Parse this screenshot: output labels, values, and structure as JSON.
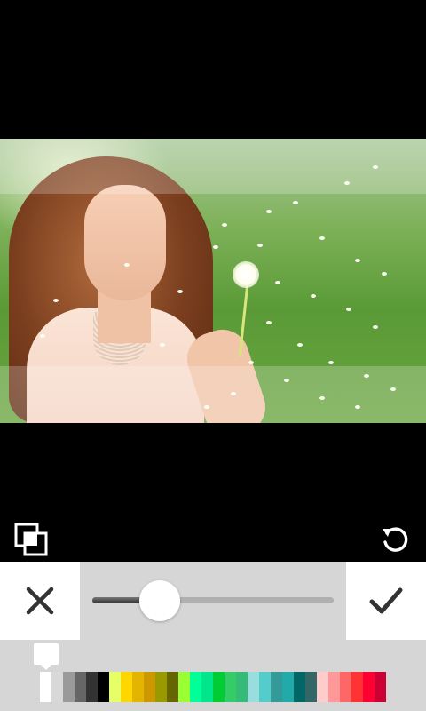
{
  "photo": {
    "description_icon": "photo-canvas"
  },
  "toolbar": {
    "compare_icon": "compare-layers-icon",
    "reset_icon": "rotate-reset-icon"
  },
  "controls": {
    "cancel_icon": "close-icon",
    "confirm_icon": "checkmark-icon",
    "slider_value": 0.28
  },
  "palette": {
    "selected_index": 0,
    "colors": [
      "#ffffff",
      "#d8d8d8",
      "#9a9a9a",
      "#666666",
      "#333333",
      "#000000",
      "#e6ff66",
      "#ffd600",
      "#e3b400",
      "#cc9900",
      "#999900",
      "#666600",
      "#99ff33",
      "#00ff99",
      "#00e68a",
      "#00cc33",
      "#33cc66",
      "#33bb77",
      "#99dddd",
      "#55cccc",
      "#339999",
      "#22aaaa",
      "#006666",
      "#336666",
      "#ffcccc",
      "#ff9999",
      "#ff6666",
      "#ff3333",
      "#ff0033",
      "#cc0033"
    ]
  }
}
